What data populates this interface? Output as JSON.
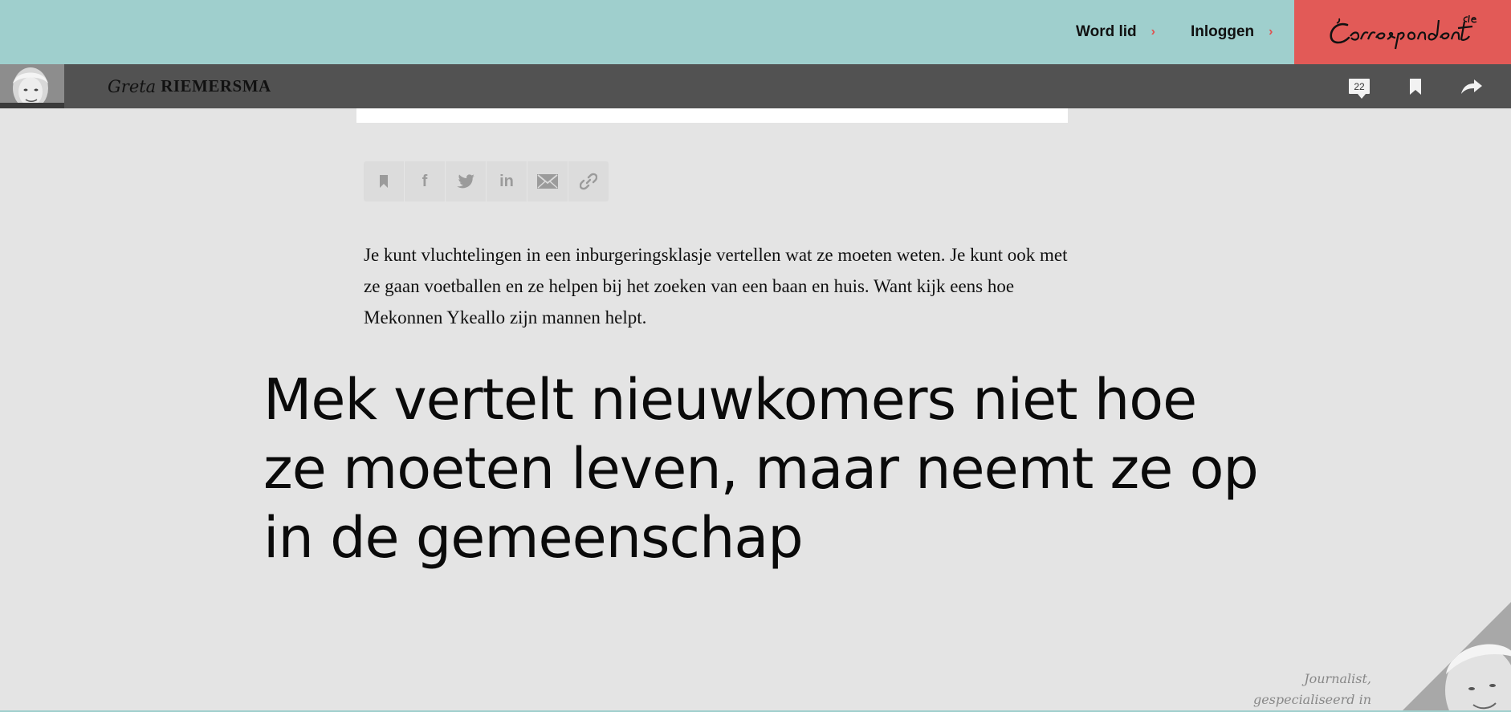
{
  "header": {
    "join_label": "Word lid",
    "login_label": "Inloggen",
    "brand_name": "de Correspondent",
    "accent_color": "#e25a57",
    "bar_color": "#9fcfcd"
  },
  "author_bar": {
    "first_name": "Greta",
    "last_name": "RIEMERSMA",
    "comment_count": "22",
    "icons": [
      "comment-icon",
      "bookmark-icon",
      "share-arrow-icon"
    ]
  },
  "share_buttons": [
    {
      "name": "bookmark",
      "icon": "bookmark-icon"
    },
    {
      "name": "facebook",
      "icon": "facebook-icon",
      "glyph": "f"
    },
    {
      "name": "twitter",
      "icon": "twitter-icon"
    },
    {
      "name": "linkedin",
      "icon": "linkedin-icon",
      "glyph": "in"
    },
    {
      "name": "email",
      "icon": "email-icon"
    },
    {
      "name": "link",
      "icon": "link-icon"
    }
  ],
  "article": {
    "intro": "Je kunt vluchtelingen in een inburgeringsklasje vertellen wat ze moeten weten. Je kunt ook met ze gaan voetballen en ze helpen bij het zoeken van een baan en huis. Want kijk eens hoe Mekonnen Ykeallo zijn mannen helpt.",
    "headline": "Mek vertelt nieuwkomers niet hoe ze moeten leven, maar neemt ze op in de gemeenschap"
  },
  "author_bio": {
    "line1": "Journalist,",
    "line2": "gespecialiseerd in"
  }
}
